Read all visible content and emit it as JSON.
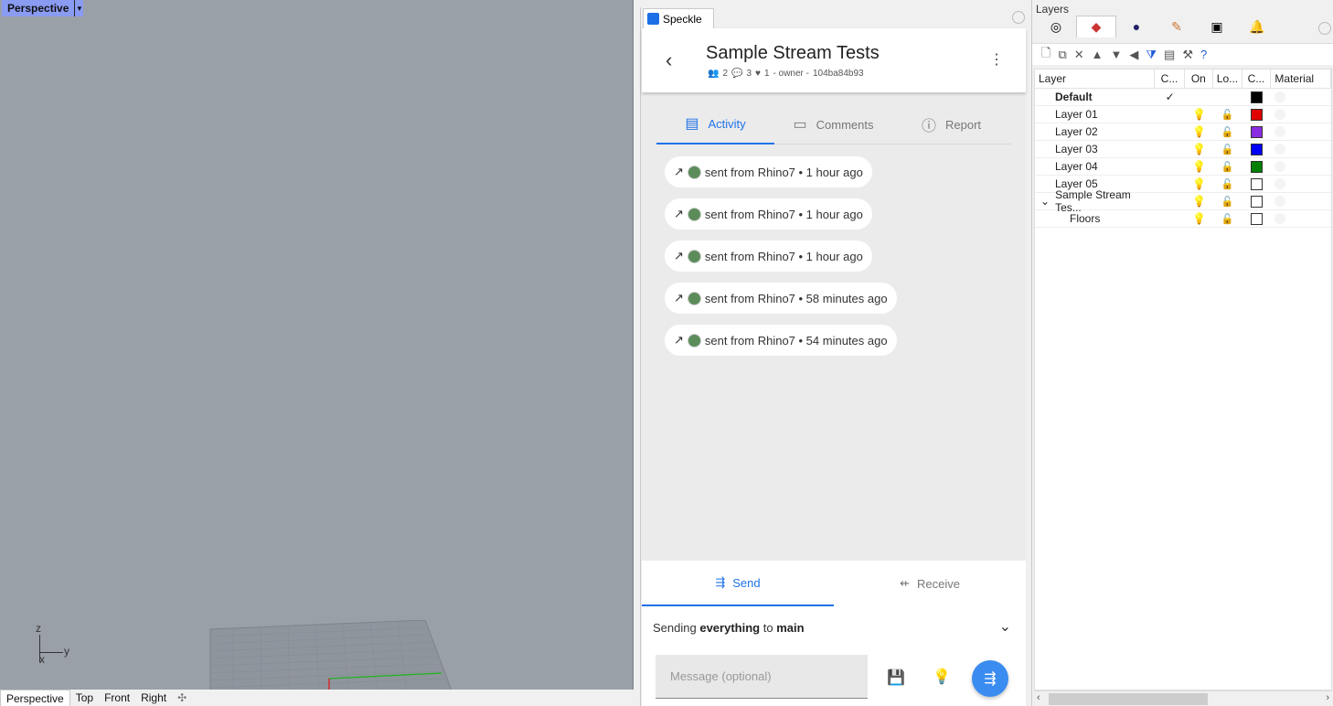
{
  "viewport": {
    "title": "Perspective",
    "axis_z": "z",
    "axis_x": "x",
    "axis_y": "y",
    "tabs": [
      "Perspective",
      "Top",
      "Front",
      "Right"
    ],
    "add_icon": "add-viewport-icon"
  },
  "speckle": {
    "tab_label": "Speckle",
    "title": "Sample Stream Tests",
    "meta": {
      "collaborators": "2",
      "comments": "3",
      "favorites": "1",
      "role": "- owner -",
      "stream_id": "104ba84b93"
    },
    "tabs": [
      {
        "label": "Activity",
        "icon": "activity-icon"
      },
      {
        "label": "Comments",
        "icon": "comments-icon"
      },
      {
        "label": "Report",
        "icon": "info-icon"
      }
    ],
    "activity": [
      {
        "text": "sent from Rhino7 • 1 hour ago"
      },
      {
        "text": "sent from Rhino7 • 1 hour ago"
      },
      {
        "text": "sent from Rhino7 • 1 hour ago"
      },
      {
        "text": "sent from Rhino7 • 58 minutes ago"
      },
      {
        "text": "sent from Rhino7 • 54 minutes ago"
      }
    ],
    "send_tab": "Send",
    "receive_tab": "Receive",
    "sending_prefix": "Sending",
    "sending_what": "everything",
    "sending_to": "to",
    "sending_branch": "main",
    "message_placeholder": "Message (optional)",
    "accent_color": "#1e73e8"
  },
  "layers": {
    "title": "Layers",
    "columns": {
      "layer": "Layer",
      "current": "C...",
      "on": "On",
      "lock": "Lo...",
      "color": "C...",
      "material": "Material"
    },
    "rows": [
      {
        "name": "Default",
        "current": "✓",
        "color": "#000000",
        "bold": true
      },
      {
        "name": "Layer 01",
        "color": "#e00000"
      },
      {
        "name": "Layer 02",
        "color": "#8a2be2"
      },
      {
        "name": "Layer 03",
        "color": "#0000ff"
      },
      {
        "name": "Layer 04",
        "color": "#008000"
      },
      {
        "name": "Layer 05",
        "color": "#ffffff"
      },
      {
        "name": "Sample Stream Tes...",
        "color": "#ffffff",
        "expander": "v"
      },
      {
        "name": "Floors",
        "color": "#ffffff",
        "indent": true
      }
    ]
  }
}
